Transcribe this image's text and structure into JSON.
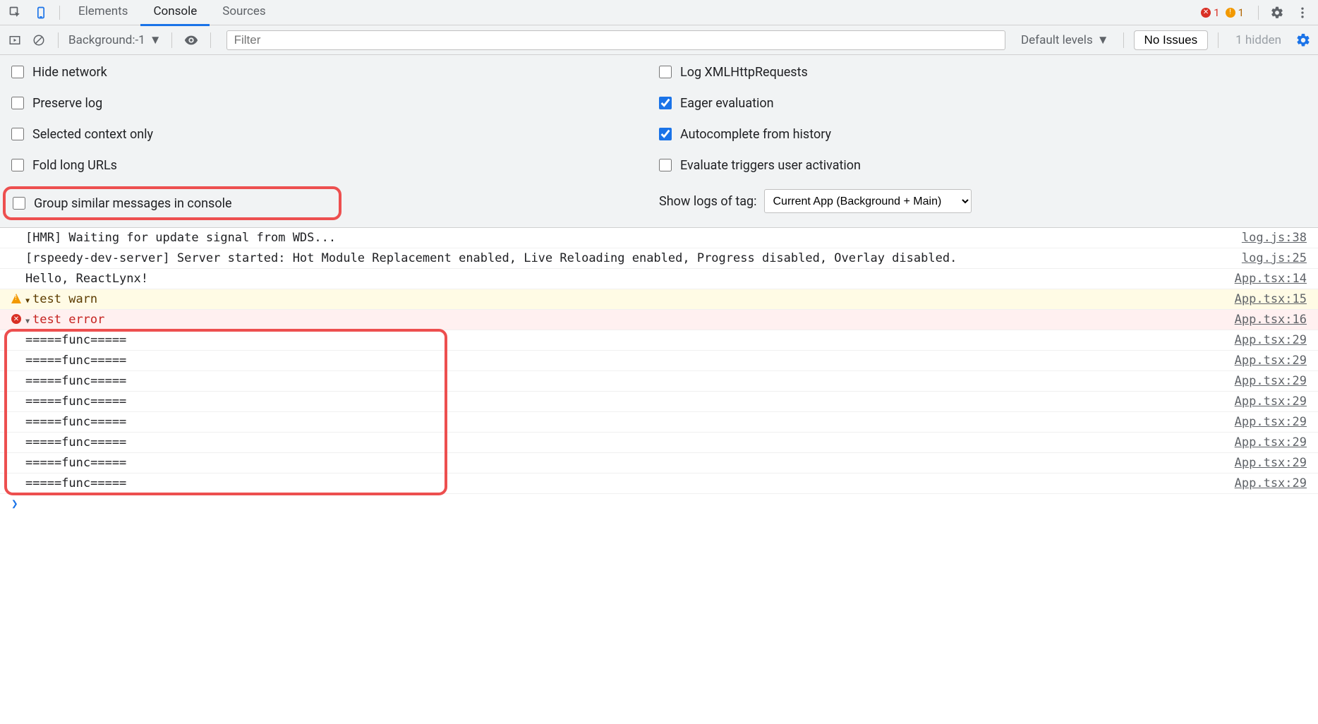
{
  "header": {
    "tabs": [
      "Elements",
      "Console",
      "Sources"
    ],
    "active_tab_index": 1,
    "error_count": "1",
    "warn_count": "1"
  },
  "toolbar": {
    "context_label": "Background:-1",
    "filter_placeholder": "Filter",
    "levels_label": "Default levels",
    "issues_button": "No Issues",
    "hidden_label": "1 hidden"
  },
  "settings": {
    "left": [
      {
        "label": "Hide network",
        "checked": false
      },
      {
        "label": "Preserve log",
        "checked": false
      },
      {
        "label": "Selected context only",
        "checked": false
      },
      {
        "label": "Fold long URLs",
        "checked": false
      },
      {
        "label": "Group similar messages in console",
        "checked": false,
        "highlight": true
      }
    ],
    "right": [
      {
        "label": "Log XMLHttpRequests",
        "checked": false
      },
      {
        "label": "Eager evaluation",
        "checked": true
      },
      {
        "label": "Autocomplete from history",
        "checked": true
      },
      {
        "label": "Evaluate triggers user activation",
        "checked": false
      }
    ],
    "tag_label": "Show logs of tag:",
    "tag_value": "Current App (Background + Main)"
  },
  "logs": [
    {
      "type": "log",
      "msg": "[HMR] Waiting for update signal from WDS...",
      "src": "log.js:38"
    },
    {
      "type": "log",
      "msg": "[rspeedy-dev-server] Server started: Hot Module Replacement enabled, Live Reloading enabled, Progress disabled, Overlay disabled.",
      "src": "log.js:25"
    },
    {
      "type": "log",
      "msg": "Hello, ReactLynx!",
      "src": "App.tsx:14"
    },
    {
      "type": "warn",
      "msg": "test warn",
      "src": "App.tsx:15",
      "expandable": true
    },
    {
      "type": "error",
      "msg": "test error",
      "src": "App.tsx:16",
      "expandable": true
    }
  ],
  "func_logs": {
    "msg": "=====func=====",
    "src": "App.tsx:29",
    "count": 8
  },
  "prompt": "❯"
}
